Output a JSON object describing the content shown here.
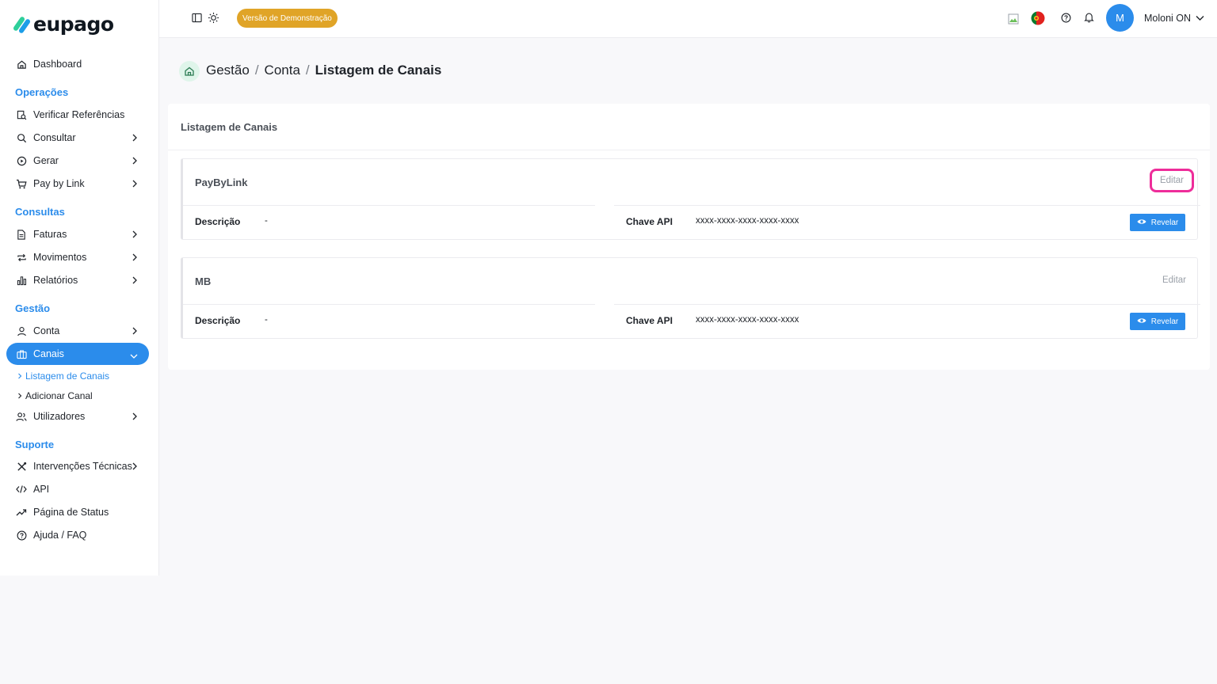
{
  "brand": {
    "name": "eupago"
  },
  "sidebar": {
    "dashboard": "Dashboard",
    "sections": {
      "operacoes": "Operações",
      "consultas": "Consultas",
      "gestao": "Gestão",
      "suporte": "Suporte"
    },
    "items": {
      "verificar": "Verificar Referências",
      "consultar": "Consultar",
      "gerar": "Gerar",
      "paybylink": "Pay by Link",
      "faturas": "Faturas",
      "movimentos": "Movimentos",
      "relatorios": "Relatórios",
      "conta": "Conta",
      "canais": "Canais",
      "utilizadores": "Utilizadores",
      "intervencoes": "Intervenções Técnicas",
      "api": "API",
      "status": "Página de Status",
      "ajuda": "Ajuda / FAQ"
    },
    "sub_canais": {
      "listagem": "Listagem de Canais",
      "adicionar": "Adicionar Canal"
    }
  },
  "topbar": {
    "demo_badge": "Versão de Demonstração",
    "avatar_initial": "M",
    "user_name": "Moloni ON"
  },
  "breadcrumb": {
    "level1": "Gestão",
    "level2": "Conta",
    "current": "Listagem de Canais"
  },
  "card": {
    "title": "Listagem de Canais",
    "channels": [
      {
        "name": "PayByLink",
        "edit": "Editar",
        "desc_label": "Descrição",
        "desc_value": "-",
        "api_label": "Chave API",
        "api_value": "xxxx-xxxx-xxxx-xxxx-xxxx",
        "reveal": "Revelar"
      },
      {
        "name": "MB",
        "edit": "Editar",
        "desc_label": "Descrição",
        "desc_value": "-",
        "api_label": "Chave API",
        "api_value": "xxxx-xxxx-xxxx-xxxx-xxxx",
        "reveal": "Revelar"
      }
    ]
  },
  "colors": {
    "accent": "#2b8ceb",
    "demo": "#e0a427",
    "highlight": "#ee2d9a"
  }
}
